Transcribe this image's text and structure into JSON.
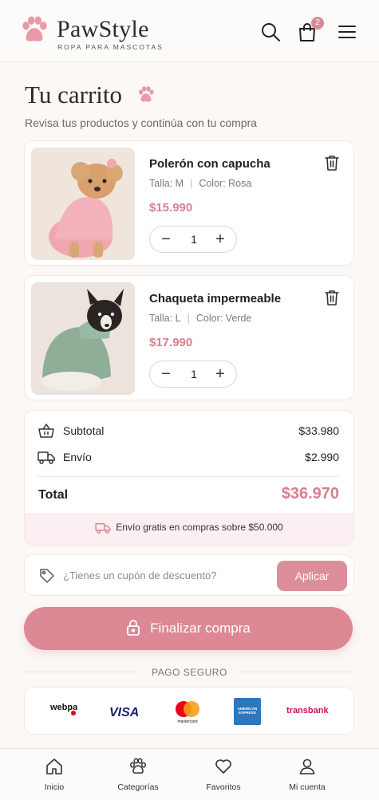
{
  "header": {
    "brand": "PawStyle",
    "tagline": "ROPA PARA MASCOTAS",
    "cart_count": "2",
    "icons": [
      "paw-logo-icon",
      "search-icon",
      "shopping-bag-icon",
      "menu-icon"
    ]
  },
  "page": {
    "title": "Tu carrito",
    "subtitle": "Revisa tus productos y continúa con tu compra"
  },
  "cart": {
    "items": [
      {
        "name": "Polerón con capucha",
        "size": "Talla: M",
        "color": "Color: Rosa",
        "price": "$15.990",
        "quantity": "1",
        "image": "dog-pink-hoodie-photo"
      },
      {
        "name": "Chaqueta impermeable",
        "size": "Talla: L",
        "color": "Color: Verde",
        "price": "$17.990",
        "quantity": "1",
        "image": "dog-green-jacket-photo"
      }
    ]
  },
  "summary": {
    "subtotal_label": "Subtotal",
    "subtotal_value": "$33.980",
    "shipping_label": "Envío",
    "shipping_value": "$2.990",
    "total_label": "Total",
    "total_value": "$36.970",
    "free_shipping_note": "Envío gratis en compras sobre $50.000"
  },
  "coupon": {
    "placeholder": "¿Tienes un cupón de descuento?",
    "apply_label": "Aplicar"
  },
  "checkout": {
    "label": "Finalizar compra"
  },
  "payment": {
    "secure_label": "PAGO SEGURO",
    "methods": [
      "webpay",
      "VISA",
      "mastercard",
      "AMERICAN EXPRESS",
      "transbank"
    ]
  },
  "nav": {
    "items": [
      {
        "label": "Inicio",
        "icon": "home-icon"
      },
      {
        "label": "Categorías",
        "icon": "paw-icon"
      },
      {
        "label": "Favoritos",
        "icon": "heart-icon"
      },
      {
        "label": "Mi cuenta",
        "icon": "user-icon"
      }
    ]
  },
  "colors": {
    "accent": "#dc8895",
    "price": "#d5808f",
    "background": "#fbf8f5"
  }
}
